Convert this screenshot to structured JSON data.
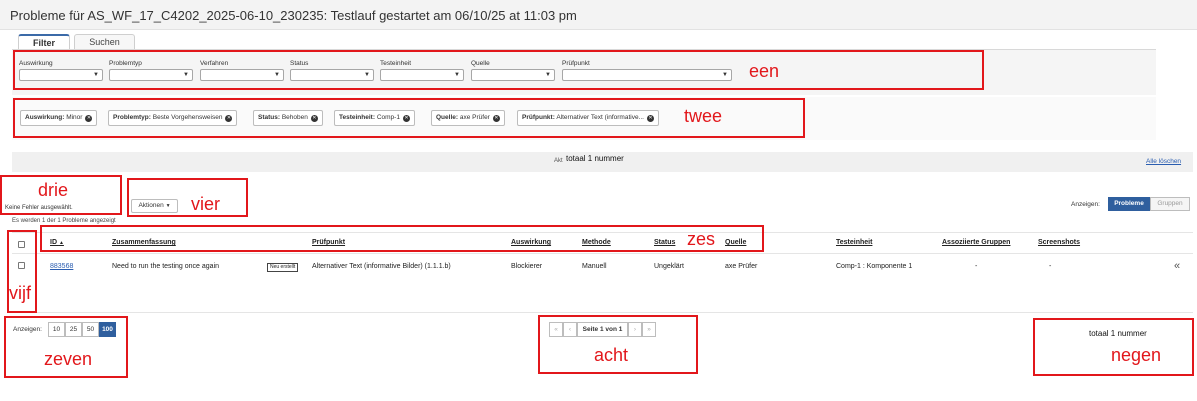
{
  "header": {
    "title": "Probleme für AS_WF_17_C4202_2025-06-10_230235: Testlauf gestartet am 06/10/25 at 11:03 pm"
  },
  "tabs": [
    {
      "label": "Filter"
    },
    {
      "label": "Suchen"
    }
  ],
  "filters": [
    {
      "label": "Auswirkung"
    },
    {
      "label": "Problemtyp"
    },
    {
      "label": "Verfahren"
    },
    {
      "label": "Status"
    },
    {
      "label": "Testeinheit"
    },
    {
      "label": "Quelle"
    },
    {
      "label": "Prüfpunkt"
    }
  ],
  "chips": [
    {
      "key": "Auswirkung:",
      "value": "Minor"
    },
    {
      "key": "Problemtyp:",
      "value": "Beste Vorgehensweisen"
    },
    {
      "key": "Status:",
      "value": "Behoben"
    },
    {
      "key": "Testeinheit:",
      "value": "Comp-1"
    },
    {
      "key": "Quelle:",
      "value": "axe Prüfer"
    },
    {
      "key": "Prüfpunkt:",
      "value": "Alternativer Text (informative..."
    }
  ],
  "summary": {
    "prefix": "Akt",
    "total": "totaal 1 nummer",
    "clear_all": "Alle löschen"
  },
  "selection": {
    "none_selected": "Keine Fehler ausgewählt.",
    "actions": "Aktionen",
    "showing_count": "Es werden 1 der 1 Probleme angezeigt"
  },
  "view": {
    "label": "Anzeigen:",
    "problems": "Probleme",
    "groups": "Gruppen"
  },
  "table": {
    "columns": [
      "ID",
      "Zusammenfassung",
      "Prüfpunkt",
      "Auswirkung",
      "Methode",
      "Status",
      "Quelle",
      "Testeinheit",
      "Assoziierte Gruppen",
      "Screenshots"
    ],
    "sort_indicator": "▲",
    "rows": [
      {
        "id": "883568",
        "summary": "Need to run the testing once again",
        "badge": "Neu erstellt",
        "checkpoint": "Alternativer Text (informative Bilder) (1.1.1.b)",
        "impact": "Blockierer",
        "method": "Manuell",
        "status": "Ungeklärt",
        "source": "axe Prüfer",
        "test_unit": "Comp-1 : Komponente 1",
        "groups": "-",
        "screenshots": "-",
        "expand": "«"
      }
    ]
  },
  "pagination": {
    "label": "Anzeigen:",
    "sizes": [
      "10",
      "25",
      "50",
      "100"
    ],
    "active_size": "100",
    "page_text": "Seite 1 von 1",
    "total": "totaal 1 nummer"
  },
  "annotations": {
    "een": "een",
    "twee": "twee",
    "drie": "drie",
    "vier": "vier",
    "vijf": "vijf",
    "zes": "zes",
    "zeven": "zeven",
    "acht": "acht",
    "negen": "negen"
  },
  "colors": {
    "annotation": "#e2171b",
    "primary": "#2f5f9e",
    "link": "#2a5db0"
  }
}
